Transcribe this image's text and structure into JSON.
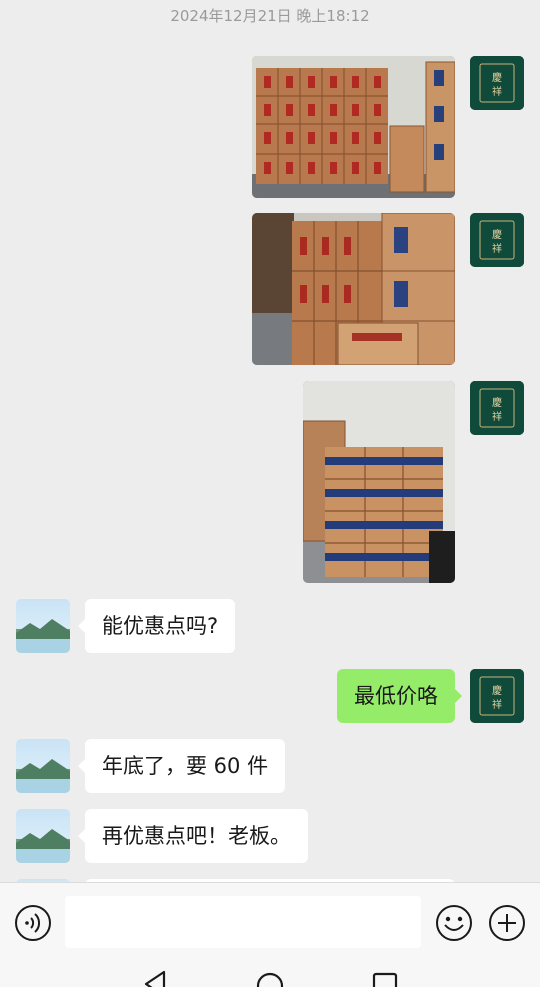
{
  "timestamp": "2024年12月21日 晚上18:12",
  "messages": [
    {
      "sender": "self",
      "type": "image"
    },
    {
      "sender": "self",
      "type": "image"
    },
    {
      "sender": "self",
      "type": "image"
    },
    {
      "sender": "other",
      "type": "text",
      "text": "能优惠点吗?"
    },
    {
      "sender": "self",
      "type": "text",
      "text": "最低价咯"
    },
    {
      "sender": "other",
      "type": "text",
      "text": "年底了，要 60 件"
    },
    {
      "sender": "other",
      "type": "text",
      "text": "再优惠点吧！老板。"
    }
  ],
  "colors": {
    "background": "#ededed",
    "outgoing_bubble": "#95ec69",
    "incoming_bubble": "#ffffff",
    "self_avatar": "#0f4a3a"
  },
  "input_bar": {
    "icons": [
      "voice-icon",
      "emoji-icon",
      "plus-icon"
    ]
  },
  "nav_bar": {
    "icons": [
      "back-icon",
      "home-icon",
      "recents-icon"
    ]
  }
}
